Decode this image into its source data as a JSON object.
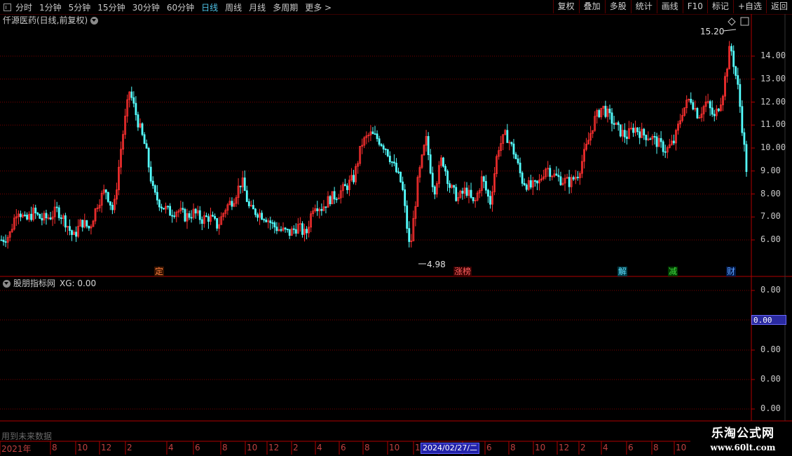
{
  "toolbar": {
    "periods": [
      "分时",
      "1分钟",
      "5分钟",
      "15分钟",
      "30分钟",
      "60分钟",
      "日线",
      "周线",
      "月线",
      "多周期",
      "更多 >"
    ],
    "active_period": "日线",
    "buttons": [
      "复权",
      "叠加",
      "多股",
      "统计",
      "画线",
      "F10",
      "标记",
      "+自选",
      "返回"
    ]
  },
  "chart_title": "仟源医药(日线,前复权)",
  "indicator": {
    "name": "股朋指标网",
    "xg_label": "XG: 0.00"
  },
  "price_axis": [
    "14.00",
    "13.00",
    "12.00",
    "11.00",
    "10.00",
    "9.00",
    "8.00",
    "7.00",
    "6.00"
  ],
  "price_values": [
    14,
    13,
    12,
    11,
    10,
    9,
    8,
    7,
    6
  ],
  "indicator_axis": [
    "0.00",
    "0.00",
    "0.00",
    "0.00",
    "0.00"
  ],
  "cursor_value": "0.00",
  "annotations": {
    "high": "15.20",
    "low": "4.98"
  },
  "markers": [
    {
      "text": "定",
      "color": "#ff8040",
      "bg": "#3a1400",
      "xpos": 230
    },
    {
      "text": "涨榜",
      "color": "#ff6060",
      "bg": "#3a0000",
      "xpos": 657
    },
    {
      "text": "解",
      "color": "#60e0ff",
      "bg": "#003a44",
      "xpos": 891
    },
    {
      "text": "减",
      "color": "#40e040",
      "bg": "#003a00",
      "xpos": 963
    },
    {
      "text": "财",
      "color": "#60a0ff",
      "bg": "#001a4a",
      "xpos": 1046
    }
  ],
  "footer_note": "用到未来数据",
  "date_axis": [
    "2021年",
    "8",
    "10",
    "12",
    "2",
    "4",
    "6",
    "8",
    "10",
    "12",
    "2",
    "4",
    "6",
    "8",
    "10",
    "12",
    "2",
    "4",
    "6",
    "8",
    "10",
    "12",
    "2",
    "4",
    "6",
    "8",
    "10",
    "12"
  ],
  "date_cursor": "2024/02/27/二",
  "logo": {
    "line1": "乐淘公式网",
    "line2": "www.60lt.com"
  },
  "colors": {
    "up": "#ff3030",
    "down": "#54ffff",
    "grid": "#7a0000",
    "frame": "#b00000"
  },
  "chart_data": {
    "type": "candlestick",
    "title": "仟源医药(日线,前复权)",
    "ylim": [
      4.98,
      15.2
    ],
    "high": 15.2,
    "low": 4.98,
    "path_x_date_axis": [
      "2021年",
      "8",
      "10",
      "12",
      "2",
      "4",
      "6",
      "8",
      "10",
      "12",
      "2",
      "4",
      "6",
      "8",
      "10",
      "12",
      "2",
      "4",
      "6",
      "8",
      "10",
      "12",
      "2",
      "4",
      "6",
      "8",
      "10",
      "12"
    ],
    "approx_close_path": [
      6.0,
      6.2,
      7.4,
      6.8,
      7.2,
      6.9,
      7.0,
      7.3,
      6.8,
      6.1,
      6.8,
      6.5,
      7.6,
      8.2,
      7.2,
      10.2,
      12.5,
      11.2,
      10.0,
      8.0,
      7.5,
      7.2,
      7.3,
      7.0,
      7.2,
      6.9,
      7.0,
      6.6,
      7.4,
      7.8,
      8.6,
      7.3,
      7.2,
      7.0,
      6.6,
      6.4,
      6.3,
      6.6,
      6.2,
      7.6,
      7.4,
      7.8,
      8.0,
      8.3,
      8.7,
      10.2,
      10.6,
      10.4,
      10.0,
      9.2,
      8.4,
      5.5,
      8.6,
      10.4,
      8.1,
      9.6,
      8.3,
      7.8,
      8.2,
      7.5,
      8.7,
      7.6,
      10.0,
      10.6,
      9.8,
      8.6,
      8.3,
      8.4,
      9.2,
      8.8,
      8.6,
      8.5,
      8.9,
      10.0,
      11.2,
      11.8,
      11.3,
      10.8,
      10.5,
      10.9,
      10.6,
      10.5,
      10.2,
      9.9,
      10.3,
      11.6,
      12.2,
      11.4,
      12.0,
      11.3,
      12.3,
      14.5,
      12.5,
      9.1
    ]
  }
}
